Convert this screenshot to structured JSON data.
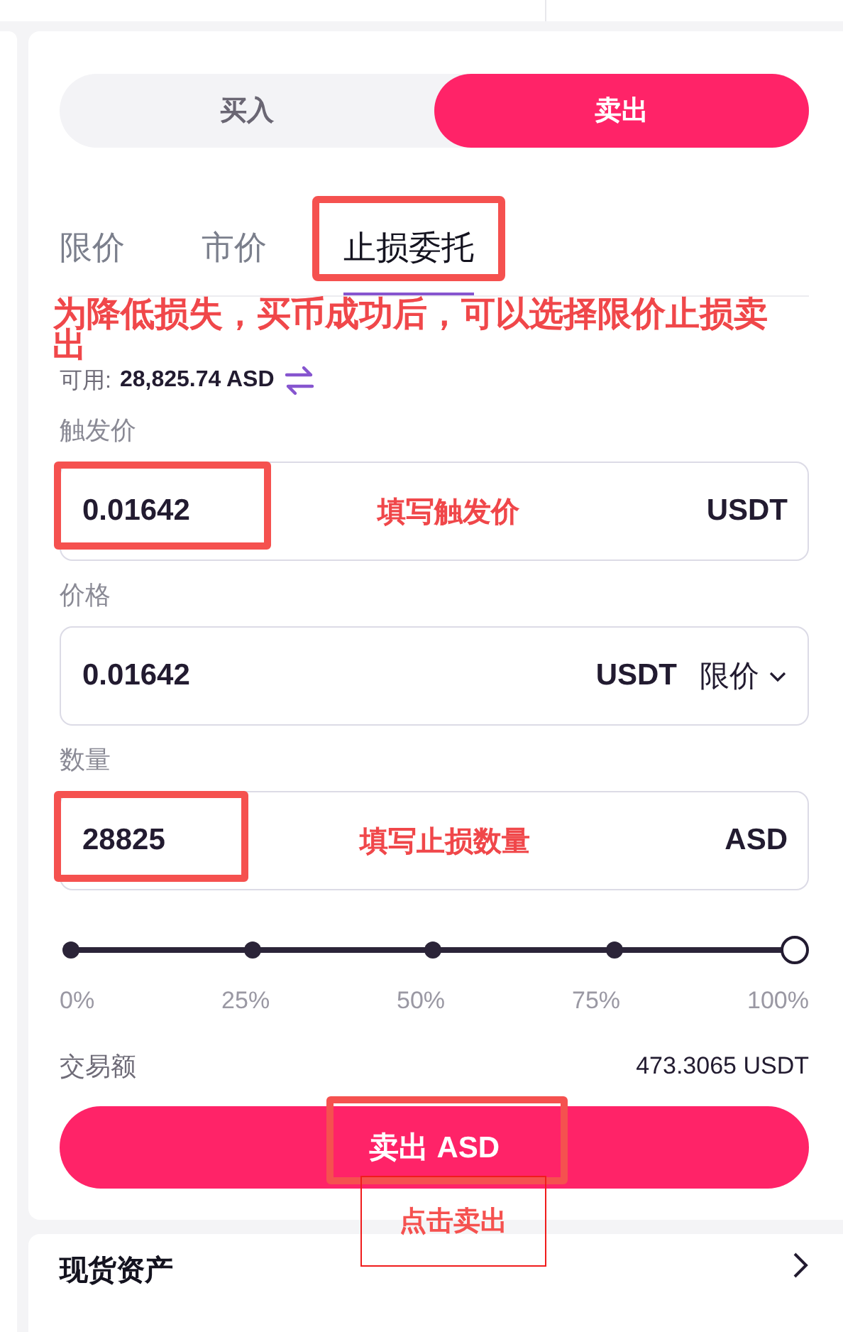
{
  "side_toggle": [
    {
      "label": "买入",
      "selected": false
    },
    {
      "label": "卖出",
      "selected": true
    }
  ],
  "order_tabs": [
    {
      "label": "限价",
      "selected": false,
      "highlighted": false
    },
    {
      "label": "市价",
      "selected": false,
      "highlighted": false
    },
    {
      "label": "止损委托",
      "selected": true,
      "highlighted": true
    }
  ],
  "note": "为降低损失，买币成功后，可以选择限价止损卖出",
  "available": {
    "label": "可用:",
    "value": "28,825.74 ASD"
  },
  "fields": [
    {
      "label": "触发价",
      "value": "0.01642",
      "unit": "USDT",
      "note": "填写触发价",
      "highlighted": true
    },
    {
      "label": "价格",
      "value": "0.01642",
      "unit": "USDT",
      "dropdown": "限价",
      "highlighted": false
    },
    {
      "label": "数量",
      "value": "28825",
      "unit": "ASD",
      "note": "填写止损数量",
      "highlighted": true
    }
  ],
  "slider": {
    "level": 1,
    "marks": [
      "0%",
      "25%",
      "50%",
      "75%",
      "100%"
    ]
  },
  "total": {
    "label": "交易额",
    "value": "473.3065 USDT"
  },
  "submit": {
    "label": "卖出 ASD",
    "highlighted": true,
    "note": "点击卖出"
  },
  "next_section": {
    "title": "现货资产"
  }
}
